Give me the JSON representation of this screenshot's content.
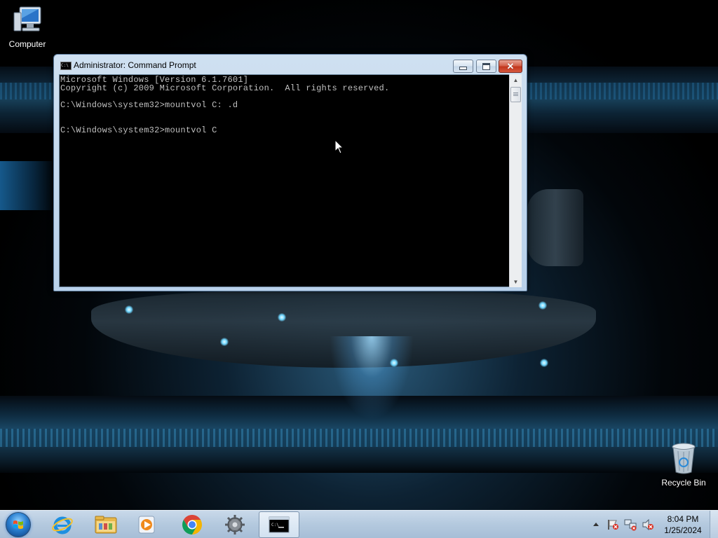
{
  "desktop": {
    "icons": [
      {
        "label": "Computer",
        "icon": "computer-icon"
      },
      {
        "label": "Recycle Bin",
        "icon": "recycle-bin-icon"
      }
    ]
  },
  "window": {
    "title": "Administrator: Command Prompt",
    "icon": "cmd-icon",
    "controls": [
      "minimize",
      "maximize",
      "close"
    ],
    "console_lines": [
      "Microsoft Windows [Version 6.1.7601]",
      "Copyright (c) 2009 Microsoft Corporation.  All rights reserved.",
      "",
      "C:\\Windows\\system32>mountvol C: .d",
      "",
      "",
      "C:\\Windows\\system32>mountvol C"
    ]
  },
  "taskbar": {
    "start": "start-orb-icon",
    "pinned": [
      {
        "name": "internet-explorer",
        "icon": "ie-icon"
      },
      {
        "name": "windows-explorer",
        "icon": "folder-icon"
      },
      {
        "name": "media-player",
        "icon": "media-player-icon"
      },
      {
        "name": "chrome",
        "icon": "chrome-icon"
      },
      {
        "name": "settings-tool",
        "icon": "gear-icon"
      },
      {
        "name": "command-prompt",
        "icon": "cmd-icon",
        "active": true
      }
    ],
    "tray": {
      "icons": [
        "show-hidden-icons-icon",
        "action-center-icon",
        "network-icon",
        "volume-muted-icon"
      ],
      "time": "8:04 PM",
      "date": "1/25/2024"
    }
  },
  "colors": {
    "console_bg": "#000000",
    "console_text": "#c0c0c0",
    "close_button": "#c2361c",
    "taskbar": "#b5cadf"
  }
}
